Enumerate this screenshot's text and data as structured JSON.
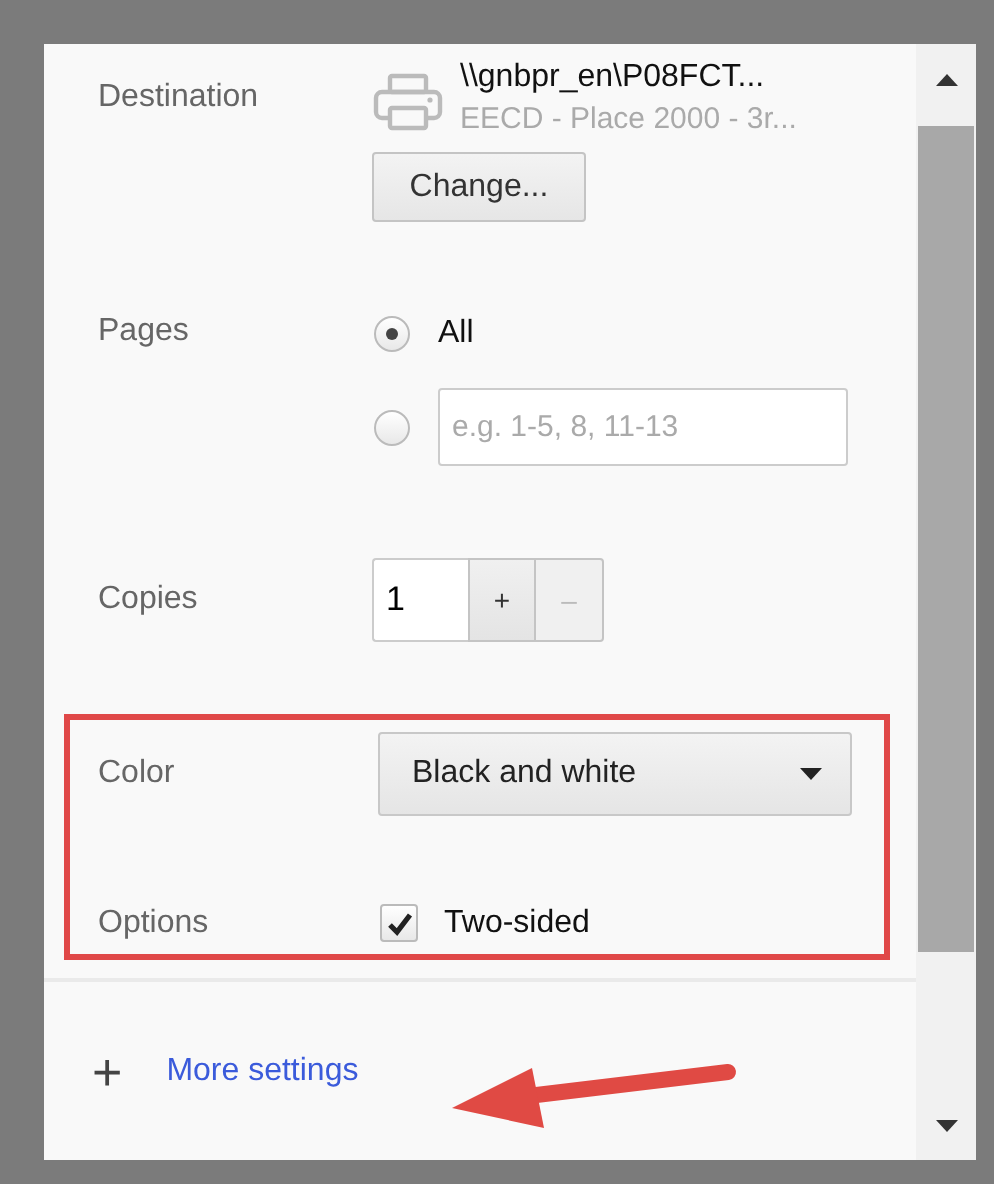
{
  "destination": {
    "label": "Destination",
    "printer_name": "\\\\gnbpr_en\\P08FCT...",
    "printer_detail": "EECD - Place 2000 - 3r...",
    "change_button": "Change..."
  },
  "pages": {
    "label": "Pages",
    "options": [
      {
        "kind": "all",
        "label": "All",
        "selected": true
      },
      {
        "kind": "range",
        "placeholder": "e.g. 1-5, 8, 11-13",
        "selected": false
      }
    ]
  },
  "copies": {
    "label": "Copies",
    "value": "1",
    "increment": {
      "label": "+",
      "disabled": false
    },
    "decrement": {
      "label": "–",
      "disabled": true
    }
  },
  "color": {
    "label": "Color",
    "value": "Black and white"
  },
  "options": {
    "label": "Options",
    "checkbox": {
      "label": "Two-sided",
      "checked": true
    }
  },
  "more_settings": {
    "icon": "+",
    "label": "More settings"
  }
}
